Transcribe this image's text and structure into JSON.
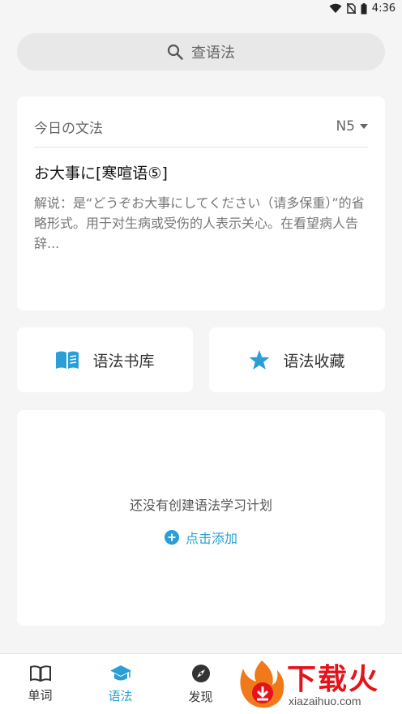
{
  "status_bar": {
    "time": "4:36"
  },
  "search": {
    "placeholder": "查语法",
    "icon": "search-icon"
  },
  "daily": {
    "title": "今日の文法",
    "level": "N5",
    "grammar_title": "お大事に[寒喧语⑤]",
    "description": "解说：是“どうぞお大事にしてください（请多保重）”的省略形式。用于对生病或受伤的人表示关心。在看望病人告辞..."
  },
  "quick_actions": {
    "library_label": "语法书库",
    "favorites_label": "语法收藏"
  },
  "plan": {
    "empty_text": "还没有创建语法学习计划",
    "add_label": "点击添加"
  },
  "nav": {
    "items": [
      {
        "label": "单词",
        "icon": "book-icon"
      },
      {
        "label": "语法",
        "icon": "graduation-cap-icon"
      },
      {
        "label": "发现",
        "icon": "compass-icon"
      }
    ]
  },
  "watermark": {
    "text": "下载火",
    "url": "xiazaihuo.com"
  },
  "colors": {
    "accent": "#2a9fd6",
    "background": "#f5f5f5",
    "watermark": "#e5121a"
  }
}
